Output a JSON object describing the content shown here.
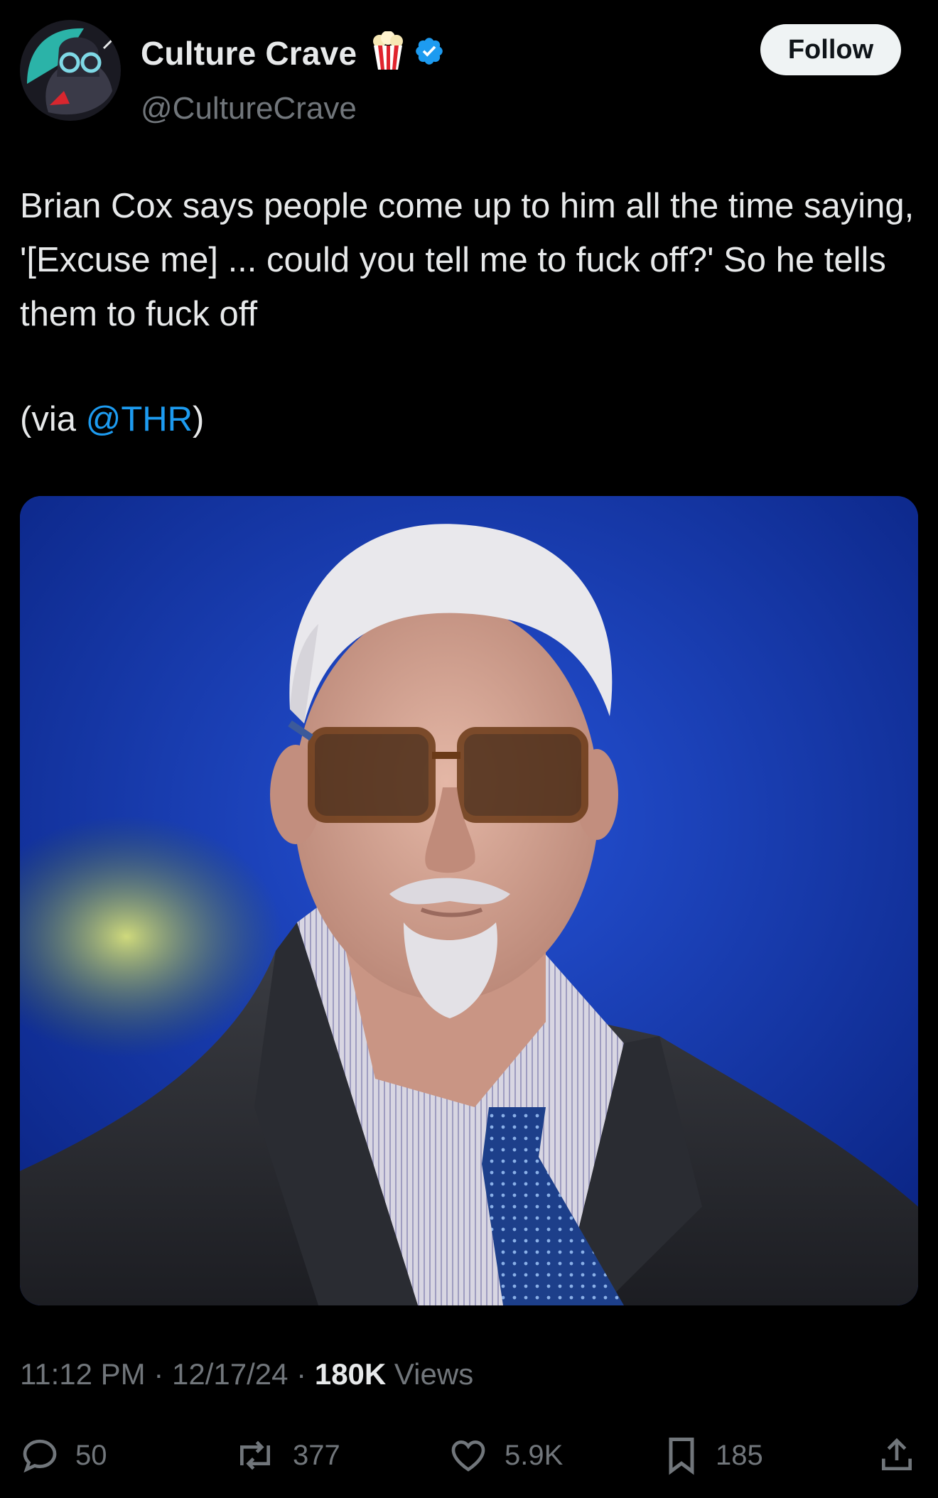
{
  "author": {
    "display_name": "Culture Crave",
    "handle": "@CultureCrave",
    "follow_label": "Follow"
  },
  "tweet": {
    "text": "Brian Cox says people come up to him all the time saying, '[Excuse me] ... could you tell me to fuck off?' So he tells them to fuck off",
    "via_prefix": "(via ",
    "via_mention": "@THR",
    "via_suffix": ")"
  },
  "meta": {
    "time": "11:12 PM",
    "date": "12/17/24",
    "separator": "·",
    "views_count": "180K",
    "views_label": "Views"
  },
  "actions": {
    "replies": "50",
    "reposts": "377",
    "likes": "5.9K",
    "bookmarks": "185"
  },
  "colors": {
    "background": "#000000",
    "text": "#e7e9ea",
    "muted": "#71767b",
    "link": "#1d9bf0",
    "verified": "#1d9bf0"
  },
  "icons": [
    "popcorn-icon",
    "verified-badge-icon",
    "reply-icon",
    "repost-icon",
    "like-icon",
    "bookmark-icon",
    "share-icon"
  ]
}
